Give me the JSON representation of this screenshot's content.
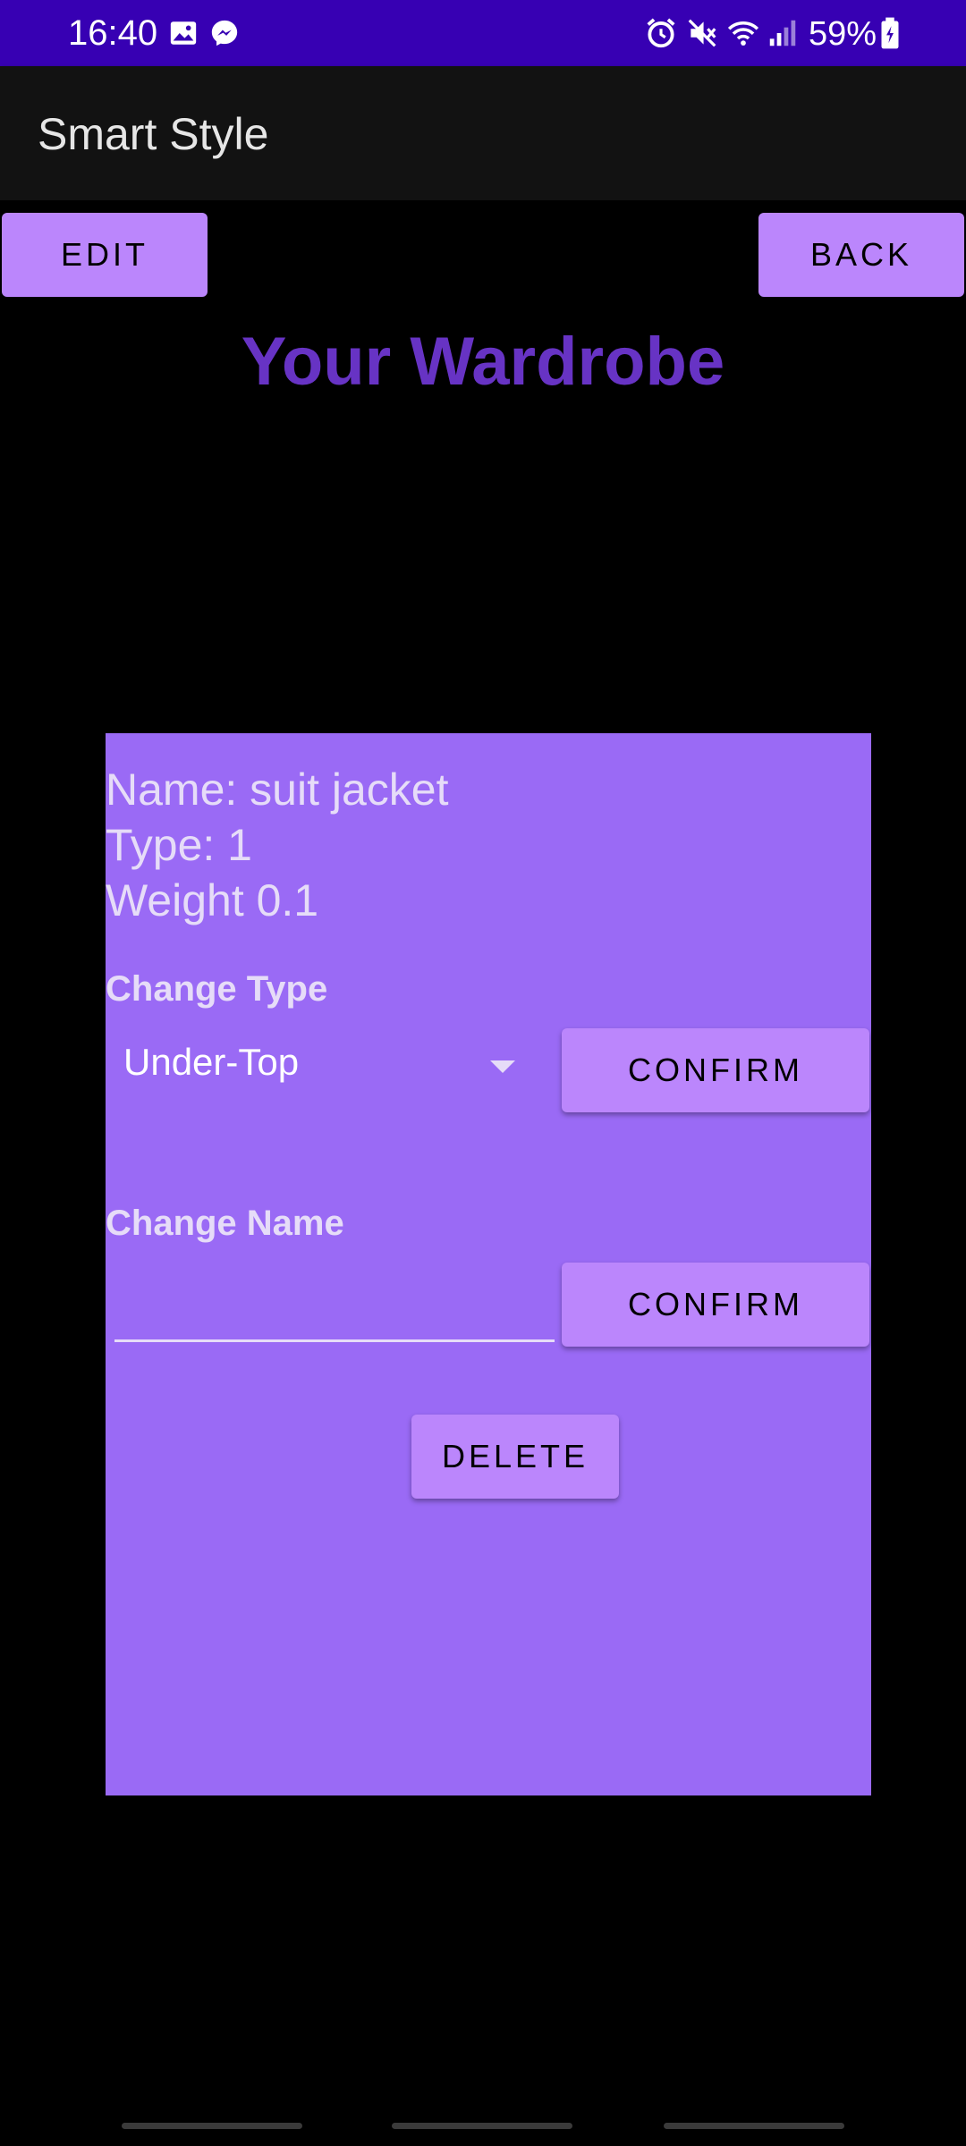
{
  "status_bar": {
    "time": "16:40",
    "battery": "59%",
    "left_icons": [
      "image-icon",
      "messenger-icon"
    ],
    "right_icons": [
      "alarm-icon",
      "mute-icon",
      "wifi-icon",
      "signal-icon",
      "battery-charging-icon"
    ],
    "background": "#3700b3"
  },
  "app_bar": {
    "title": "Smart Style"
  },
  "toolbar": {
    "edit_label": "EDIT",
    "back_label": "BACK"
  },
  "page": {
    "title": "Your Wardrobe"
  },
  "item": {
    "name_line": "Name: suit jacket",
    "type_line": "Type: 1",
    "weight_line": "Weight 0.1"
  },
  "change_type": {
    "label": "Change Type",
    "selected": "Under-Top",
    "confirm_label": "CONFIRM"
  },
  "change_name": {
    "label": "Change Name",
    "value": "",
    "confirm_label": "CONFIRM"
  },
  "delete_label": "DELETE",
  "colors": {
    "accent": "#bb86fc",
    "card": "#9a6af5",
    "title": "#6733c4",
    "status_bar": "#3700b3",
    "app_bar": "#121212",
    "background": "#000000"
  }
}
